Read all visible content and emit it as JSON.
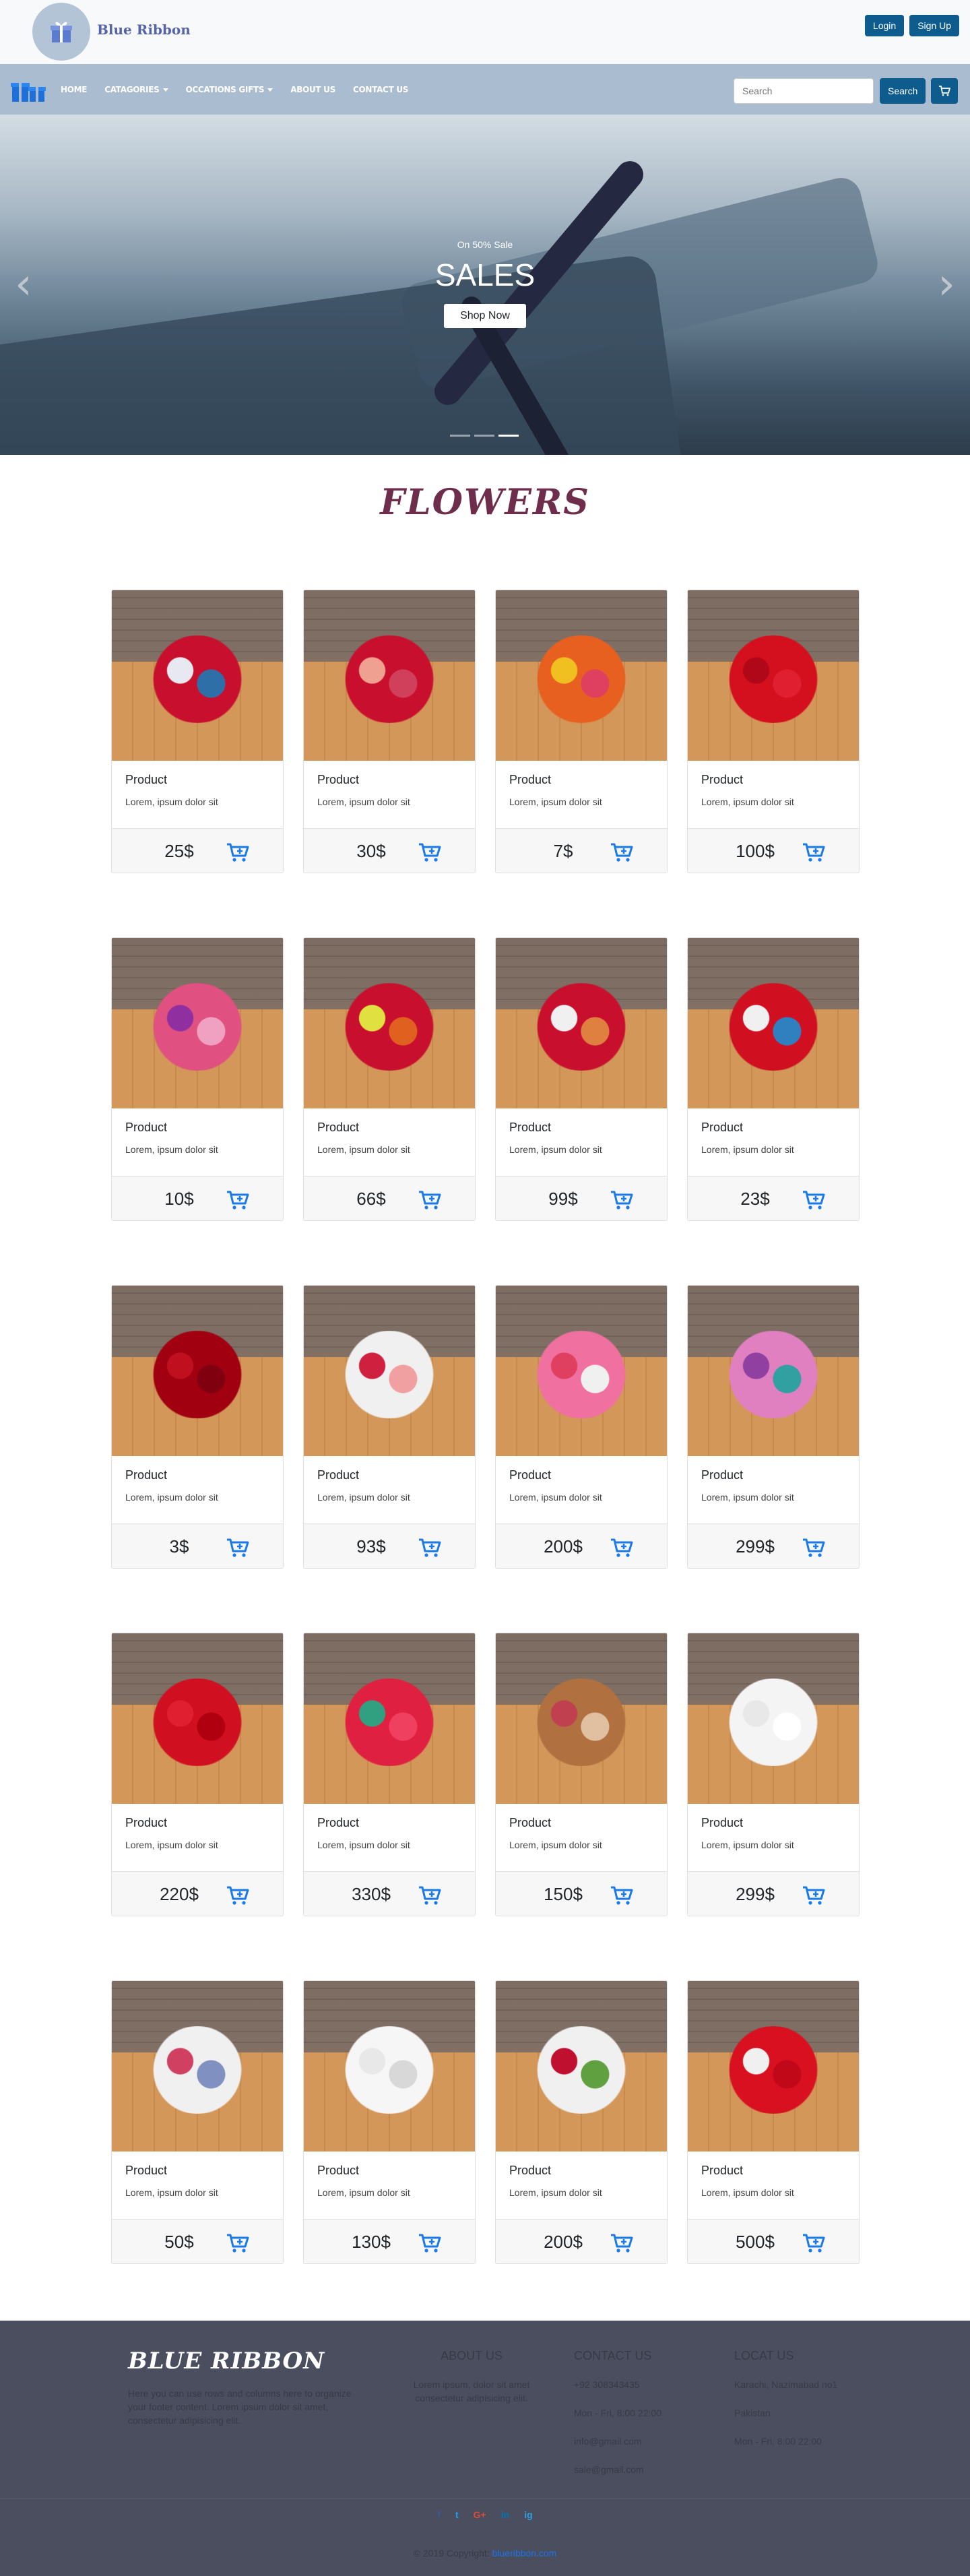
{
  "header": {
    "brand": "Blue Ribbon",
    "login_label": "Login",
    "signup_label": "Sign Up"
  },
  "nav": {
    "items": [
      {
        "label": "HOME",
        "dropdown": false
      },
      {
        "label": "CATAGORIES",
        "dropdown": true
      },
      {
        "label": "OCCATIONS GIFTS",
        "dropdown": true
      },
      {
        "label": "ABOUT US",
        "dropdown": false
      },
      {
        "label": "CONTACT US",
        "dropdown": false
      }
    ],
    "search_placeholder": "Search",
    "search_button": "Search",
    "accent": "#0d5c8d",
    "bar_color": "#aabccf"
  },
  "hero": {
    "subtitle": "On 50% Sale",
    "title": "SALES",
    "button": "Shop Now",
    "prev_icon": "chevron-left-icon",
    "next_icon": "chevron-right-icon",
    "slides": 3,
    "active_slide": 3
  },
  "section": {
    "title": "FLOWERS",
    "title_color": "#6e2d4b"
  },
  "products": [
    {
      "name": "Product",
      "desc": "Lorem, ipsum dolor sit",
      "price": "25$",
      "colors": [
        "#c8102e",
        "#e8e8f0",
        "#2f6fa8"
      ]
    },
    {
      "name": "Product",
      "desc": "Lorem, ipsum dolor sit",
      "price": "30$",
      "colors": [
        "#c8102e",
        "#f0a090",
        "#d0405a"
      ]
    },
    {
      "name": "Product",
      "desc": "Lorem, ipsum dolor sit",
      "price": "7$",
      "colors": [
        "#e86020",
        "#f0c020",
        "#e04060"
      ]
    },
    {
      "name": "Product",
      "desc": "Lorem, ipsum dolor sit",
      "price": "100$",
      "colors": [
        "#d4101e",
        "#b00818",
        "#e02030"
      ]
    },
    {
      "name": "Product",
      "desc": "Lorem, ipsum dolor sit",
      "price": "10$",
      "colors": [
        "#e05080",
        "#9030a0",
        "#f0a0c0"
      ]
    },
    {
      "name": "Product",
      "desc": "Lorem, ipsum dolor sit",
      "price": "66$",
      "colors": [
        "#c8102e",
        "#e0e040",
        "#e06020"
      ]
    },
    {
      "name": "Product",
      "desc": "Lorem, ipsum dolor sit",
      "price": "99$",
      "colors": [
        "#c8102e",
        "#f0f0f0",
        "#e08040"
      ]
    },
    {
      "name": "Product",
      "desc": "Lorem, ipsum dolor sit",
      "price": "23$",
      "colors": [
        "#d01020",
        "#f0f0f0",
        "#3080c0"
      ]
    },
    {
      "name": "Product",
      "desc": "Lorem, ipsum dolor sit",
      "price": "3$",
      "colors": [
        "#a00010",
        "#c01020",
        "#800010"
      ]
    },
    {
      "name": "Product",
      "desc": "Lorem, ipsum dolor sit",
      "price": "93$",
      "colors": [
        "#f0f0f0",
        "#d02040",
        "#f0a0a0"
      ]
    },
    {
      "name": "Product",
      "desc": "Lorem, ipsum dolor sit",
      "price": "200$",
      "colors": [
        "#f070a0",
        "#e04060",
        "#f0f0f0"
      ]
    },
    {
      "name": "Product",
      "desc": "Lorem, ipsum dolor sit",
      "price": "299$",
      "colors": [
        "#e080c0",
        "#9040a0",
        "#30a0a0"
      ]
    },
    {
      "name": "Product",
      "desc": "Lorem, ipsum dolor sit",
      "price": "220$",
      "colors": [
        "#d01020",
        "#e02030",
        "#b00010"
      ]
    },
    {
      "name": "Product",
      "desc": "Lorem, ipsum dolor sit",
      "price": "330$",
      "colors": [
        "#e02040",
        "#30a080",
        "#f04060"
      ]
    },
    {
      "name": "Product",
      "desc": "Lorem, ipsum dolor sit",
      "price": "150$",
      "colors": [
        "#b07040",
        "#c04050",
        "#e0c0a0"
      ]
    },
    {
      "name": "Product",
      "desc": "Lorem, ipsum dolor sit",
      "price": "299$",
      "colors": [
        "#f4f4f4",
        "#e8e8e8",
        "#ffffff"
      ]
    },
    {
      "name": "Product",
      "desc": "Lorem, ipsum dolor sit",
      "price": "50$",
      "colors": [
        "#f0f0f0",
        "#d04060",
        "#8090c0"
      ]
    },
    {
      "name": "Product",
      "desc": "Lorem, ipsum dolor sit",
      "price": "130$",
      "colors": [
        "#f6f6f6",
        "#e8e8e8",
        "#d8d8d8"
      ]
    },
    {
      "name": "Product",
      "desc": "Lorem, ipsum dolor sit",
      "price": "200$",
      "colors": [
        "#f0f0f0",
        "#c01030",
        "#60a040"
      ]
    },
    {
      "name": "Product",
      "desc": "Lorem, ipsum dolor sit",
      "price": "500$",
      "colors": [
        "#d81020",
        "#f0f0f0",
        "#c00818"
      ]
    }
  ],
  "footer": {
    "brand": "BLUE RIBBON",
    "text": "Here you can use rows and columns here to organize your footer content. Lorem ipsum dolor sit amet, consectetur adipisicing elit.",
    "about": {
      "title": "ABOUT US",
      "text": "Lorem ipsum, dolor sit amet consectetur adipisicing elit."
    },
    "contact": {
      "title": "CONTACT US",
      "lines": [
        "+92 308343435",
        "Mon - Fri, 8:00 22:00",
        "info@gmail.com",
        "sale@gmail.com"
      ]
    },
    "location": {
      "title": "LOCAT US",
      "lines": [
        "Karachi, Nazimabad no1",
        "Pakistan",
        "Mon - Fri, 8:00 22:00"
      ]
    },
    "socials": [
      {
        "label": "f",
        "icon": "facebook-icon",
        "color": "#3b5998"
      },
      {
        "label": "t",
        "icon": "twitter-icon",
        "color": "#1da1f2"
      },
      {
        "label": "G+",
        "icon": "google-plus-icon",
        "color": "#dd4b39"
      },
      {
        "label": "in",
        "icon": "linkedin-icon",
        "color": "#0077b5"
      },
      {
        "label": "ig",
        "icon": "instagram-icon",
        "color": "#2f9fe0"
      }
    ],
    "copyright": "© 2019 Copyright:",
    "copyright_link": "blueribbon.com"
  }
}
